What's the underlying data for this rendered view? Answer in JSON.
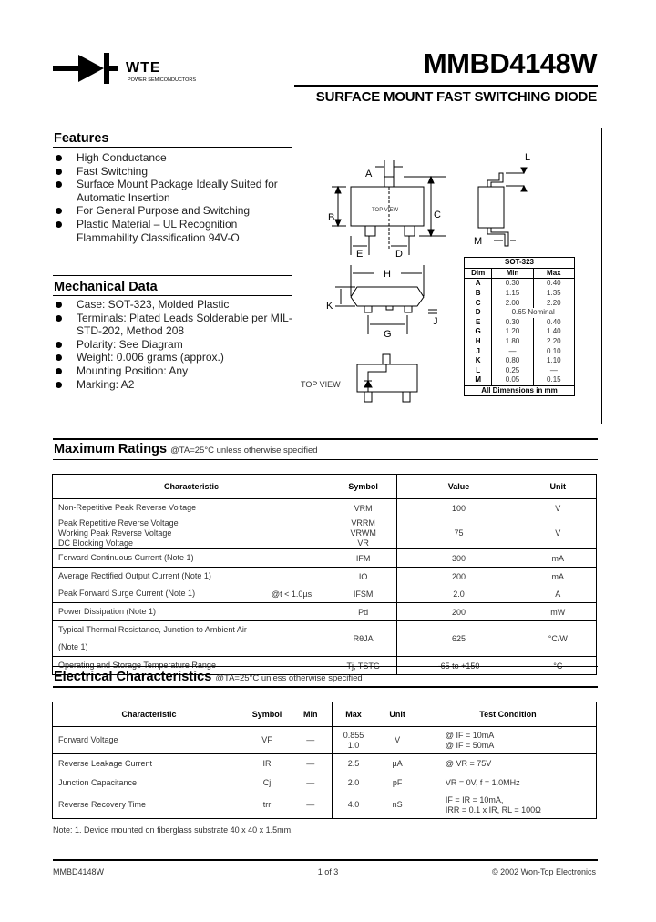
{
  "header": {
    "logo_text": "WTE",
    "logo_subtext": "POWER SEMICONDUCTORS",
    "part_number": "MMBD4148W",
    "subtitle": "SURFACE MOUNT FAST SWITCHING DIODE"
  },
  "features": {
    "title": "Features",
    "items": [
      "High Conductance",
      "Fast Switching",
      "Surface Mount Package Ideally Suited for Automatic Insertion",
      "For General Purpose and Switching",
      "Plastic Material – UL Recognition Flammability Classification 94V-O"
    ]
  },
  "mechanical": {
    "title": "Mechanical Data",
    "items": [
      "Case: SOT-323, Molded Plastic",
      "Terminals: Plated Leads Solderable per MIL-STD-202, Method 208",
      "Polarity: See Diagram",
      "Weight: 0.006 grams (approx.)",
      "Mounting Position: Any",
      "Marking: A2"
    ]
  },
  "diagram": {
    "top_view_inner": "TOP VIEW",
    "top_view_label": "TOP VIEW",
    "dim_labels": {
      "A": "A",
      "B": "B",
      "C": "C",
      "D": "D",
      "E": "E",
      "G": "G",
      "H": "H",
      "J": "J",
      "K": "K",
      "L": "L",
      "M": "M"
    }
  },
  "dims_table": {
    "title": "SOT-323",
    "headers": [
      "Dim",
      "Min",
      "Max"
    ],
    "rows": [
      {
        "dim": "A",
        "min": "0.30",
        "max": "0.40"
      },
      {
        "dim": "B",
        "min": "1.15",
        "max": "1.35"
      },
      {
        "dim": "C",
        "min": "2.00",
        "max": "2.20"
      },
      {
        "dim": "D",
        "nominal": "0.65 Nominal"
      },
      {
        "dim": "E",
        "min": "0.30",
        "max": "0.40"
      },
      {
        "dim": "G",
        "min": "1.20",
        "max": "1.40"
      },
      {
        "dim": "H",
        "min": "1.80",
        "max": "2.20"
      },
      {
        "dim": "J",
        "min": "—",
        "max": "0.10"
      },
      {
        "dim": "K",
        "min": "0.80",
        "max": "1.10"
      },
      {
        "dim": "L",
        "min": "0.25",
        "max": "—"
      },
      {
        "dim": "M",
        "min": "0.05",
        "max": "0.15"
      }
    ],
    "footer": "All Dimensions in mm"
  },
  "max_ratings": {
    "title": "Maximum Ratings",
    "condition": "@TA=25°C unless otherwise specified",
    "headers": [
      "Characteristic",
      "Symbol",
      "Value",
      "Unit"
    ],
    "rows": [
      {
        "char": "Non-Repetitive Peak Reverse Voltage",
        "cond": "",
        "sym": "VRM",
        "value": "100",
        "unit": "V"
      },
      {
        "char": "Peak Repetitive Reverse Voltage\nWorking Peak Reverse Voltage\nDC Blocking Voltage",
        "cond": "",
        "sym": "VRRM\nVRWM\nVR",
        "value": "75",
        "unit": "V"
      },
      {
        "char": "Forward Continuous Current (Note 1)",
        "cond": "",
        "sym": "IFM",
        "value": "300",
        "unit": "mA"
      },
      {
        "char": "Average Rectified Output Current (Note 1)",
        "cond": "",
        "sym": "IO",
        "value": "200",
        "unit": "mA"
      },
      {
        "char": "Peak Forward Surge Current (Note 1)",
        "cond": "@t < 1.0µs",
        "sym": "IFSM",
        "value": "2.0",
        "unit": "A"
      },
      {
        "char": "Power Dissipation (Note 1)",
        "cond": "",
        "sym": "Pd",
        "value": "200",
        "unit": "mW"
      },
      {
        "char": "Typical Thermal Resistance, Junction to Ambient Air (Note 1)",
        "cond": "",
        "sym": "RθJA",
        "value": "625",
        "unit": "°C/W"
      },
      {
        "char": "Operating and Storage Temperature Range",
        "cond": "",
        "sym": "Tj, TSTG",
        "value": "-65 to +150",
        "unit": "°C"
      }
    ]
  },
  "electrical": {
    "title": "Electrical Characteristics",
    "condition": "@TA=25°C unless otherwise specified",
    "headers": [
      "Characteristic",
      "Symbol",
      "Min",
      "Max",
      "Unit",
      "Test Condition"
    ],
    "rows": [
      {
        "char": "Forward Voltage",
        "sym": "VF",
        "min": "—",
        "max": "0.855\n1.0",
        "unit": "V",
        "test": "@ IF = 10mA\n@ IF = 50mA"
      },
      {
        "char": "Reverse Leakage Current",
        "sym": "IR",
        "min": "—",
        "max": "2.5",
        "unit": "µA",
        "test": "@ VR = 75V"
      },
      {
        "char": "Junction Capacitance",
        "sym": "Cj",
        "min": "—",
        "max": "2.0",
        "unit": "pF",
        "test": "VR = 0V, f = 1.0MHz"
      },
      {
        "char": "Reverse Recovery Time",
        "sym": "trr",
        "min": "—",
        "max": "4.0",
        "unit": "nS",
        "test": "IF = IR = 10mA,\nIRR = 0.1 x IR, RL = 100Ω"
      }
    ]
  },
  "note": "Note:  1. Device mounted on fiberglass substrate 40 x 40 x 1.5mm.",
  "footer": {
    "left": "MMBD4148W",
    "center": "1 of 3",
    "right": "© 2002 Won-Top Electronics"
  }
}
